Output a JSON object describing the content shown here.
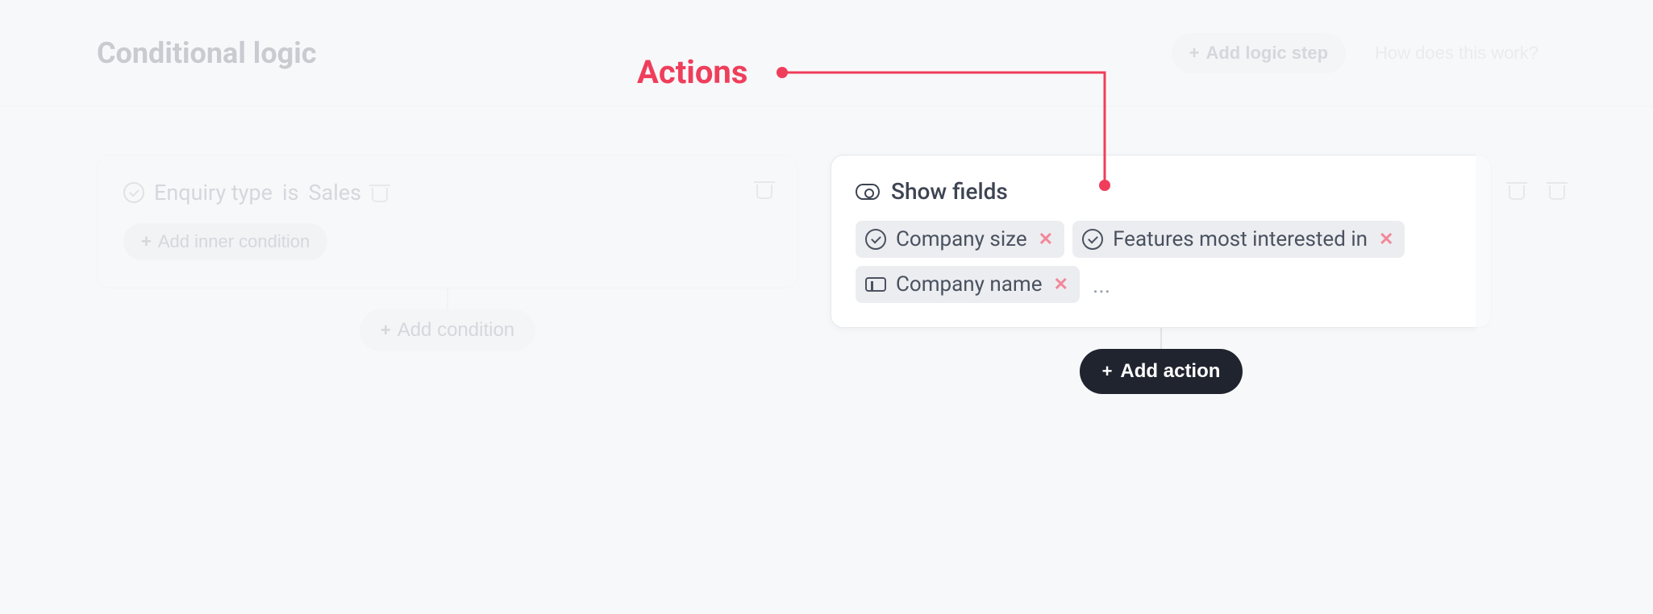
{
  "header": {
    "title": "Conditional logic",
    "add_step_label": "Add logic step",
    "how_link": "How does this work?"
  },
  "annotation": {
    "label": "Actions",
    "color": "#ef3e5b"
  },
  "condition": {
    "field": "Enquiry type",
    "operator": "is",
    "value": "Sales",
    "add_inner_label": "Add inner condition",
    "add_condition_label": "Add condition"
  },
  "action": {
    "heading": "Show fields",
    "fields": [
      {
        "icon": "circle-check",
        "label": "Company size"
      },
      {
        "icon": "circle-check",
        "label": "Features most interested in"
      },
      {
        "icon": "textbox",
        "label": "Company name"
      }
    ],
    "ellipsis": "...",
    "add_action_label": "Add action"
  }
}
